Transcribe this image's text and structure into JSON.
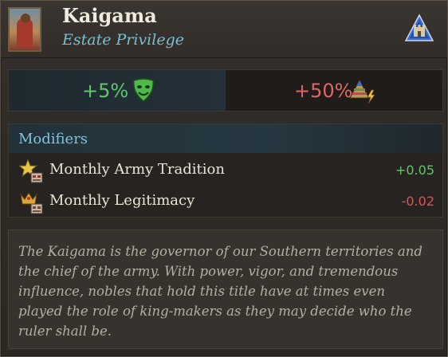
{
  "header": {
    "title": "Kaigama",
    "subtitle": "Estate Privilege",
    "portrait_icon": "kaigama-portrait",
    "estate_icon": "nobility-estate-icon"
  },
  "stats": {
    "loyalty": {
      "value": "+5%",
      "icon": "loyalty-mask-icon",
      "color": "#5ec86a"
    },
    "influence": {
      "value": "+50%",
      "icon": "influence-pyramid-icon",
      "color": "#e06666"
    }
  },
  "modifiers": {
    "title": "Modifiers",
    "items": [
      {
        "label": "Monthly Army Tradition",
        "value": "+0.05",
        "icon": "army-tradition-star-icon",
        "color": "#5ec86a"
      },
      {
        "label": "Monthly Legitimacy",
        "value": "-0.02",
        "icon": "legitimacy-crown-icon",
        "color": "#e0525a"
      }
    ]
  },
  "description": "The Kaigama is the governor of our Southern territories and the chief of the army. With power, vigor, and tremendous influence, nobles that hold this title have at times even played the role of king-makers as they may decide who the ruler shall be."
}
